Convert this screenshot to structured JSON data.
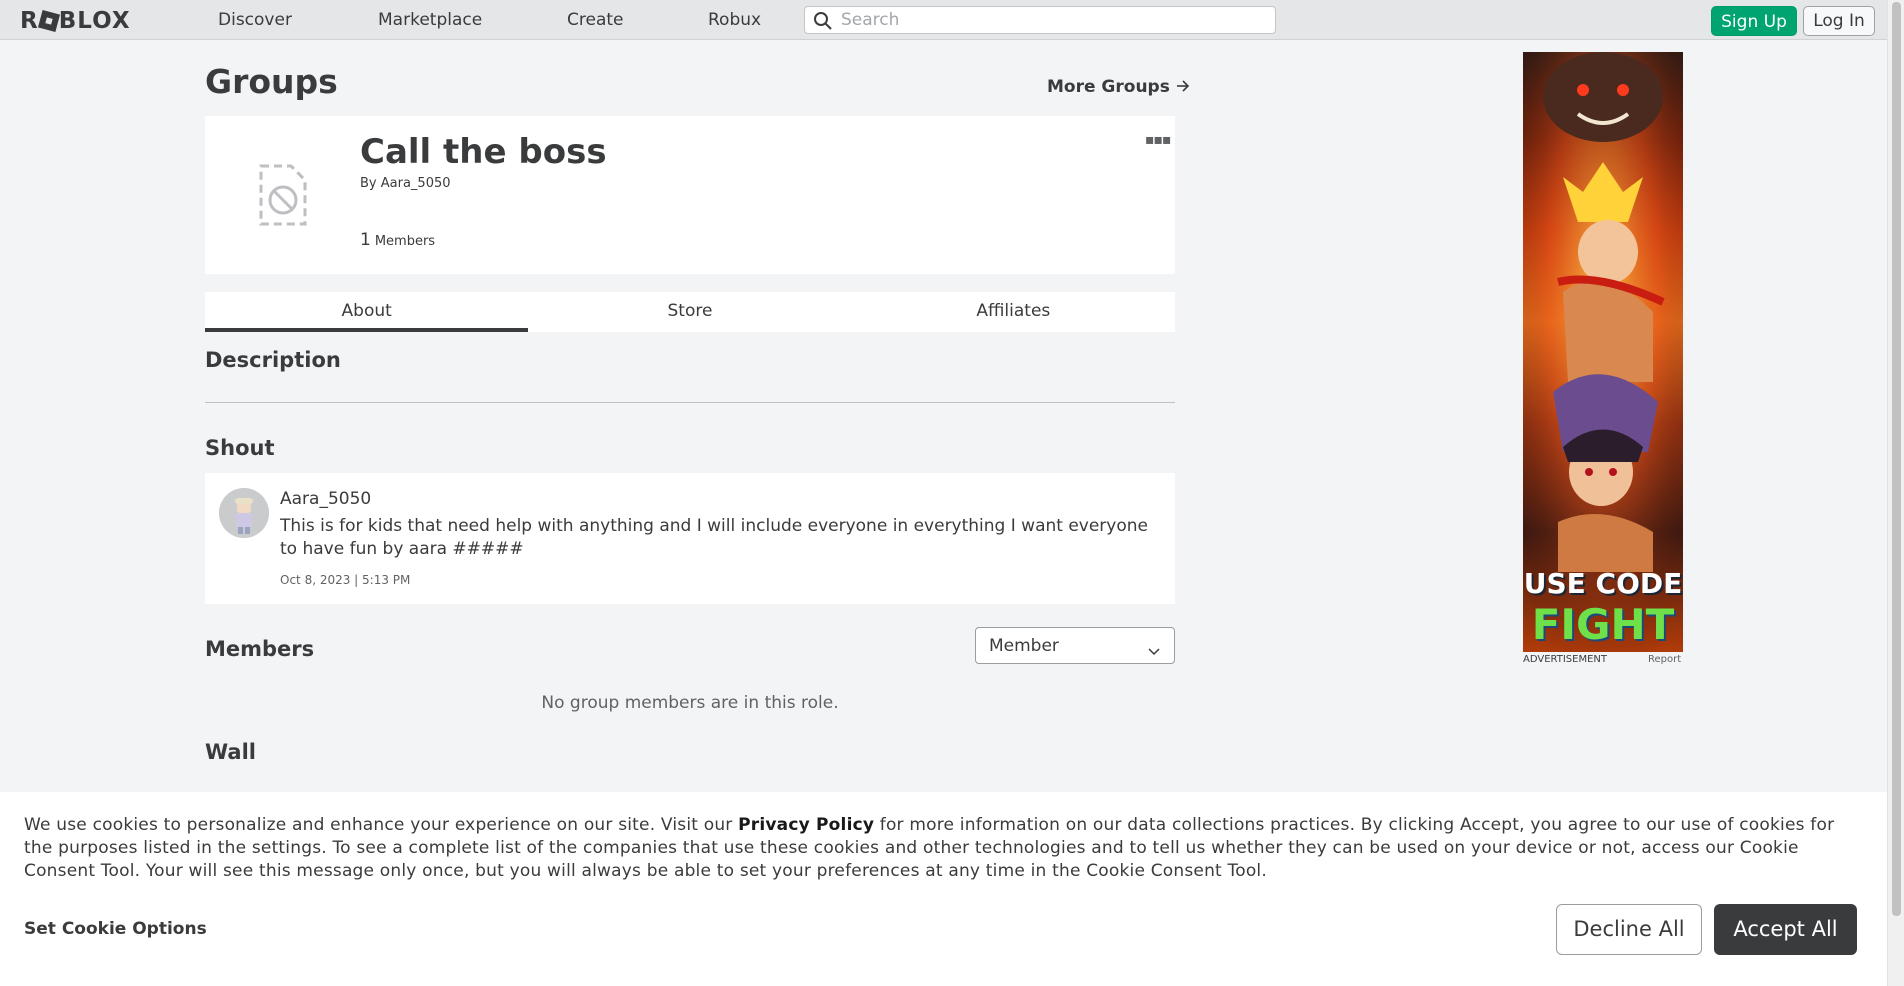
{
  "nav": {
    "logo_text": "ROBLOX",
    "links": [
      "Discover",
      "Marketplace",
      "Create",
      "Robux"
    ],
    "search_placeholder": "Search",
    "signup_label": "Sign Up",
    "login_label": "Log In"
  },
  "page": {
    "title": "Groups",
    "more_groups": "More Groups"
  },
  "group": {
    "name": "Call the boss",
    "by_label": "By",
    "owner": "Aara_5050",
    "member_count": "1",
    "members_label": "Members"
  },
  "tabs": [
    {
      "label": "About",
      "active": true
    },
    {
      "label": "Store",
      "active": false
    },
    {
      "label": "Affiliates",
      "active": false
    }
  ],
  "sections": {
    "description": "Description",
    "shout": "Shout",
    "members": "Members",
    "wall": "Wall"
  },
  "shout": {
    "user": "Aara_5050",
    "text": "This is for kids that need help with anything and I will include everyone in everything I want everyone to have fun by aara #####",
    "date": "Oct 8, 2023 | 5:13 PM"
  },
  "members": {
    "role_selected": "Member",
    "empty_text": "No group members are in this role."
  },
  "ad": {
    "line1": "USE CODE",
    "line2": "FIGHT",
    "caption": "ADVERTISEMENT",
    "report": "Report"
  },
  "cookie": {
    "text_before": "We use cookies to personalize and enhance your experience on our site. Visit our ",
    "link": "Privacy Policy",
    "text_after": " for more information on our data collections practices. By clicking Accept, you agree to our use of cookies for the purposes listed in the settings. To see a complete list of the companies that use these cookies and other technologies and to tell us whether they can be used on your device or not, access our Cookie Consent Tool. Your will see this message only once, but you will always be able to set your preferences at any time in the Cookie Consent Tool.",
    "options_label": "Set Cookie Options",
    "decline_label": "Decline All",
    "accept_label": "Accept All"
  },
  "colors": {
    "signup_green": "#00a470",
    "accept_dark": "#393b3d",
    "page_bg": "#f2f4f5"
  }
}
